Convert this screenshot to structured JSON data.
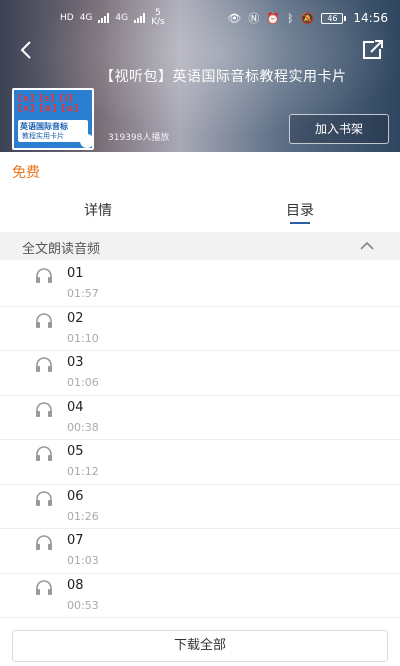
{
  "status_bar": {
    "network_left": "HD",
    "signal_1": "4G",
    "signal_2": "4G",
    "speed_value": "5",
    "speed_unit": "K/s",
    "battery": "46",
    "time": "14:56"
  },
  "header": {
    "title": "【视听包】英语国际音标教程实用卡片",
    "play_count": "319398人播放",
    "add_to_shelf_label": "加入书架",
    "cover": {
      "line1": "[ʌ] [ɜ] [i]",
      "line2": "[ʌ] [ʊ] [u]",
      "text1": "英语国际音标",
      "text2": "教程实用卡片"
    }
  },
  "price_label": "免费",
  "tabs": [
    {
      "label": "详情",
      "active": false
    },
    {
      "label": "目录",
      "active": true
    }
  ],
  "section": {
    "title": "全文朗读音频"
  },
  "tracks": [
    {
      "number": "01",
      "duration": "01:57"
    },
    {
      "number": "02",
      "duration": "01:10"
    },
    {
      "number": "03",
      "duration": "01:06"
    },
    {
      "number": "04",
      "duration": "00:38"
    },
    {
      "number": "05",
      "duration": "01:12"
    },
    {
      "number": "06",
      "duration": "01:26"
    },
    {
      "number": "07",
      "duration": "01:03"
    },
    {
      "number": "08",
      "duration": "00:53"
    }
  ],
  "download_all_label": "下载全部",
  "colors": {
    "accent_orange": "#e87722",
    "tab_underline": "#2d5fa6"
  }
}
